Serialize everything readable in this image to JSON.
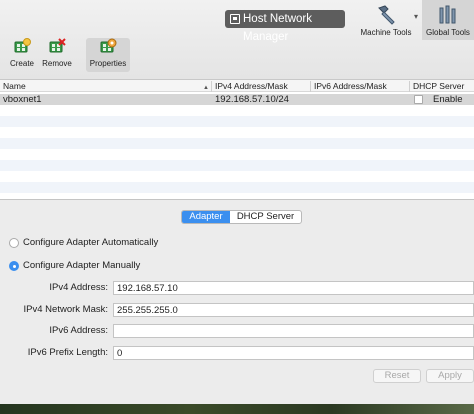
{
  "window": {
    "title": "Host Network Manager"
  },
  "toolbar": {
    "create_label": "Create",
    "remove_label": "Remove",
    "properties_label": "Properties",
    "machine_tools_label": "Machine Tools",
    "global_tools_label": "Global Tools",
    "machine_tools_chevron": "▾"
  },
  "table": {
    "columns": [
      "Name",
      "IPv4 Address/Mask",
      "IPv6 Address/Mask",
      "DHCP Server"
    ],
    "sort_indicator": "▲",
    "rows": [
      {
        "name": "vboxnet1",
        "ipv4": "192.168.57.10/24",
        "ipv6": "",
        "dhcp_enabled": false,
        "dhcp_label": "Enable"
      }
    ]
  },
  "details": {
    "tabs": [
      "Adapter",
      "DHCP Server"
    ],
    "active_tab": "Adapter",
    "configure_auto_label": "Configure Adapter Automatically",
    "configure_manual_label": "Configure Adapter Manually",
    "selected_mode": "manual",
    "fields": {
      "ipv4_address_label": "IPv4 Address:",
      "ipv4_address_value": "192.168.57.10",
      "ipv4_mask_label": "IPv4 Network Mask:",
      "ipv4_mask_value": "255.255.255.0",
      "ipv6_address_label": "IPv6 Address:",
      "ipv6_address_value": "",
      "ipv6_prefix_label": "IPv6 Prefix Length:",
      "ipv6_prefix_value": "0"
    },
    "reset_label": "Reset",
    "apply_label": "Apply"
  },
  "colors": {
    "accent": "#3b8fef",
    "selected_row": "#d6d6d6",
    "stripe": "#f0f4fa"
  },
  "icons": {
    "title": "host-network-icon",
    "create": "create-network-icon",
    "remove": "remove-network-icon",
    "properties": "properties-icon",
    "machine_tools": "hammer-icon",
    "global_tools": "global-tools-icon"
  }
}
